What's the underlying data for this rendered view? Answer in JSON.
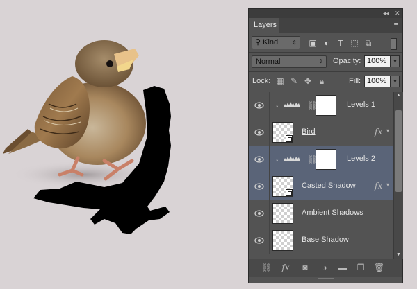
{
  "panel": {
    "tab_label": "Layers",
    "collapse_glyph": "◂◂",
    "close_glyph": "✕",
    "menu_glyph": "≡"
  },
  "filter": {
    "kind_label": "Kind",
    "icons": [
      "image-filter-icon",
      "adjustment-filter-icon",
      "type-filter-icon",
      "shape-filter-icon",
      "smart-object-filter-icon"
    ]
  },
  "blend": {
    "mode": "Normal",
    "opacity_label": "Opacity:",
    "opacity_value": "100%"
  },
  "lock": {
    "label": "Lock:",
    "fill_label": "Fill:",
    "fill_value": "100%"
  },
  "layers": [
    {
      "name": "Levels 1",
      "type": "adjustment",
      "selected": false,
      "fx": false,
      "clipped": true
    },
    {
      "name": "Bird",
      "type": "smart",
      "selected": false,
      "fx": true,
      "clipped": false
    },
    {
      "name": "Levels 2",
      "type": "adjustment",
      "selected": true,
      "fx": false,
      "clipped": true
    },
    {
      "name": "Casted Shadow",
      "type": "smart",
      "selected": true,
      "fx": true,
      "clipped": false
    },
    {
      "name": "Ambient Shadows",
      "type": "pixel",
      "selected": false,
      "fx": false,
      "clipped": false
    },
    {
      "name": "Base Shadow",
      "type": "pixel",
      "selected": false,
      "fx": false,
      "clipped": false
    }
  ],
  "fx_label": "fx",
  "bottom_icons": [
    "link-layers-icon",
    "add-style-icon",
    "add-mask-icon",
    "new-adjustment-icon",
    "new-group-icon",
    "new-layer-icon",
    "delete-layer-icon"
  ],
  "colors": {
    "canvas_bg": "#d9d3d5",
    "panel_bg": "#535353",
    "selected_bg": "#5a6478"
  }
}
